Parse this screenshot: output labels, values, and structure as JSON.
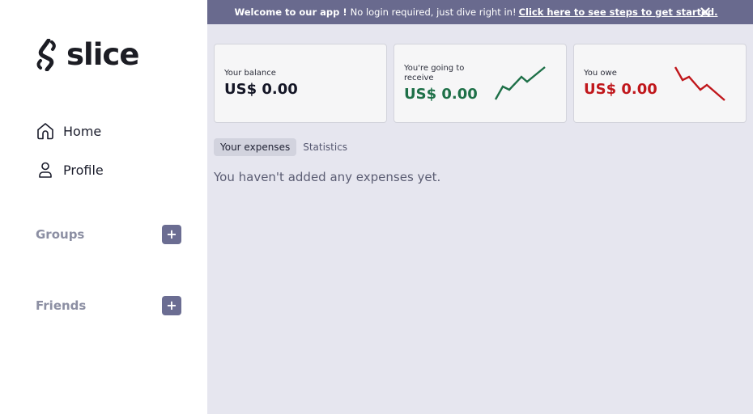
{
  "brand": {
    "name": "slice"
  },
  "nav": {
    "home": {
      "label": "Home",
      "icon": "home-icon"
    },
    "profile": {
      "label": "Profile",
      "icon": "user-icon"
    }
  },
  "sidebar_sections": {
    "groups": {
      "title": "Groups",
      "add_label": "+"
    },
    "friends": {
      "title": "Friends",
      "add_label": "+"
    }
  },
  "banner": {
    "strong": "Welcome to our app !",
    "text": "No login required, just dive right in!",
    "link": "Click here to see steps to get started.",
    "close_icon": "close-icon"
  },
  "cards": {
    "balance": {
      "label": "Your balance",
      "value": "US$ 0.00",
      "color": "#141626"
    },
    "receive": {
      "label": "You're going to receive",
      "value": "US$ 0.00",
      "color": "#1e7048",
      "trend": "up"
    },
    "owe": {
      "label": "You owe",
      "value": "US$ 0.00",
      "color": "#c0171c",
      "trend": "down"
    }
  },
  "tabs": {
    "expenses": "Your expenses",
    "statistics": "Statistics",
    "active": "expenses"
  },
  "expenses": {
    "empty_message": "You haven't added any expenses yet."
  },
  "colors": {
    "accent": "#696a8e",
    "button": "#6b6d92",
    "positive": "#1e7048",
    "negative": "#c0171c",
    "main_bg": "#e6e6ef"
  }
}
